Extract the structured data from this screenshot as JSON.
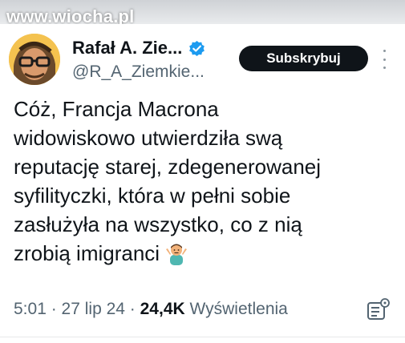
{
  "watermark": "www.wiocha.pl",
  "author": {
    "name": "Rafał A. Zie...",
    "handle": "@R_A_Ziemkie...",
    "verified_icon": "verified-badge-icon",
    "avatar": "avatar-illustration"
  },
  "subscribe_label": "Subskrybuj",
  "tweet_lines": [
    "Cóż, Francja Macrona",
    "widowiskowo utwierdziła swą",
    "reputację starej, zdegenerowanej",
    "syfilityczki, która w pełni sobie",
    "zasłużyła na wszystko, co z nią",
    "zrobią imigranci"
  ],
  "tweet_emoji": "person-shrugging-emoji",
  "meta": {
    "time": "5:01",
    "sep1": " · ",
    "date": "27 lip 24",
    "sep2": " · ",
    "views": "24,4K",
    "views_label": " Wyświetlenia"
  },
  "colors": {
    "text_primary": "#0f1419",
    "text_secondary": "#536471",
    "verified_blue": "#1d9bf0",
    "button_bg": "#0f1419"
  }
}
